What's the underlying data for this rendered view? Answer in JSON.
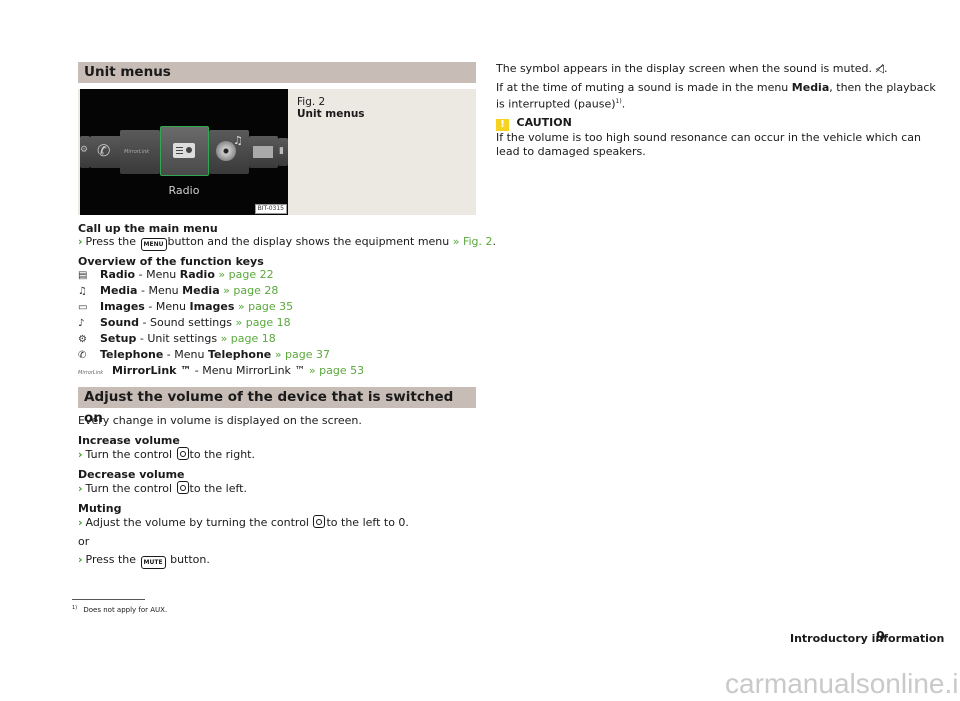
{
  "left": {
    "section1_title": "Unit menus",
    "figure": {
      "fig_label": "Fig. 2",
      "fig_title": "Unit menus",
      "screen_label": "Radio",
      "code": "BIT-0315",
      "tiles": [
        "Setup",
        "Telephone",
        "MirrorLink",
        "Radio",
        "Media",
        "Images",
        "Sound"
      ],
      "mirrorlink_text": "MirrorLink"
    },
    "call_menu": {
      "heading": "Call up the main menu",
      "step_prefix": "Press the",
      "key": "MENU",
      "step_suffix": "button and the display shows the equipment menu",
      "link": "» Fig. 2",
      "end": "."
    },
    "overview": {
      "heading": "Overview of the function keys",
      "items": [
        {
          "icon": "radio-icon",
          "glyph": "▤",
          "name": "Radio",
          "sep": " - Menu ",
          "target": "Radio",
          "link": "» page 22"
        },
        {
          "icon": "media-icon",
          "glyph": "♫",
          "name": "Media",
          "sep": " - Menu ",
          "target": "Media",
          "link": "» page 28"
        },
        {
          "icon": "images-icon",
          "glyph": "▭",
          "name": "Images",
          "sep": " - Menu ",
          "target": "Images",
          "link": "» page 35"
        },
        {
          "icon": "sound-icon",
          "glyph": "♪",
          "name": "Sound",
          "sep": " - Sound settings",
          "target": "",
          "link": "» page 18"
        },
        {
          "icon": "setup-icon",
          "glyph": "⚙",
          "name": "Setup",
          "sep": " - Unit settings",
          "target": "",
          "link": "» page 18"
        },
        {
          "icon": "telephone-icon",
          "glyph": "✆",
          "name": "Telephone",
          "sep": " - Menu ",
          "target": "Telephone",
          "link": "» page 37"
        },
        {
          "icon": "mirrorlink-icon",
          "glyph": "MirrorLink",
          "name": "MirrorLink ™",
          "sep": " - Menu MirrorLink ™",
          "target": "",
          "link": "» page 53"
        }
      ]
    },
    "section2_title": "Adjust the volume of the device that is switched on",
    "volume_intro": "Every change in volume is displayed on the screen.",
    "increase": {
      "heading": "Increase volume",
      "pre": "Turn the control",
      "post": "to the right."
    },
    "decrease": {
      "heading": "Decrease volume",
      "pre": "Turn the control",
      "post": "to the left."
    },
    "muting": {
      "heading": "Muting",
      "pre": "Adjust the volume by turning the control",
      "post": "to the left to 0."
    },
    "or": "or",
    "press_mute": {
      "pre": "Press the",
      "key": "MUTE",
      "post": "button."
    }
  },
  "right": {
    "p1": "The symbol appears in the display screen when the sound is muted.",
    "p1_symbol": "◁̸.",
    "p2_pre": "If at the time of muting a sound is made in the menu",
    "p2_bold": "Media",
    "p2_post": ", then the playback",
    "p2_line2": "is interrupted (pause)",
    "p2_footref": "1)",
    "p2_end": ".",
    "caution_title": "CAUTION",
    "caution_badge": "!",
    "caution_line1": "If the volume is too high sound resonance can occur in the vehicle which can",
    "caution_line2": "lead to damaged speakers."
  },
  "footnote": {
    "mark": "1)",
    "text": "Does not apply for AUX."
  },
  "footer": {
    "chapter": "Introductory information",
    "page": "9"
  },
  "watermark": "carmanualsonline.info",
  "colors": {
    "section_bg": "#c7bdb6",
    "figure_bg": "#ece8e2",
    "link": "#5aa83c",
    "caution": "#f5d320",
    "highlight": "#2fa84f"
  }
}
